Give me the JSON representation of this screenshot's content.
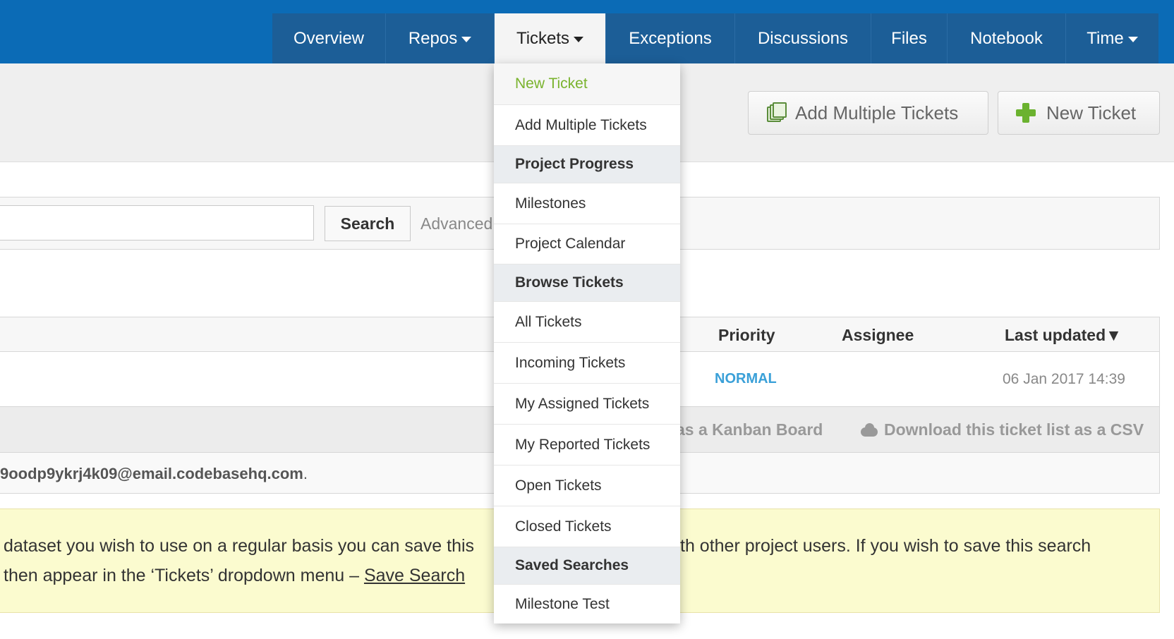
{
  "nav": {
    "items": [
      {
        "label": "Overview",
        "caret": false
      },
      {
        "label": "Repos",
        "caret": true
      },
      {
        "label": "Tickets",
        "caret": true
      },
      {
        "label": "Exceptions",
        "caret": false
      },
      {
        "label": "Discussions",
        "caret": false
      },
      {
        "label": "Files",
        "caret": false
      },
      {
        "label": "Notebook",
        "caret": false
      },
      {
        "label": "Time",
        "caret": true
      }
    ],
    "active": "Tickets"
  },
  "header": {
    "add_multiple_label": "Add Multiple Tickets",
    "new_ticket_label": "New Ticket"
  },
  "search": {
    "value": "",
    "button_label": "Search",
    "advanced_label": "Advanced"
  },
  "table": {
    "columns": [
      "Priority",
      "Assignee",
      "Last updated▼"
    ],
    "row": {
      "priority": "NORMAL",
      "last_updated": "06 Jan 2017 14:39"
    },
    "actions": {
      "kanban_label": "as a Kanban Board",
      "csv_label": "Download this ticket list as a CSV"
    },
    "email_text": "9oodp9ykrj4k09@email.codebasehq.com",
    "email_suffix": "."
  },
  "notice": {
    "line1_left": "dataset you wish to use on a regular basis you can save this",
    "line1_right": "th other project users. If you wish to save this search",
    "line2_left": "then appear in the ‘Tickets’ dropdown menu – ",
    "line2_link": "Save Search"
  },
  "dropdown": {
    "items": [
      {
        "label": "New Ticket",
        "kind": "green"
      },
      {
        "label": "Add Multiple Tickets",
        "kind": "item"
      },
      {
        "label": "Project Progress",
        "kind": "head"
      },
      {
        "label": "Milestones",
        "kind": "item"
      },
      {
        "label": "Project Calendar",
        "kind": "item"
      },
      {
        "label": "Browse Tickets",
        "kind": "head"
      },
      {
        "label": "All Tickets",
        "kind": "item"
      },
      {
        "label": "Incoming Tickets",
        "kind": "item"
      },
      {
        "label": "My Assigned Tickets",
        "kind": "item"
      },
      {
        "label": "My Reported Tickets",
        "kind": "item"
      },
      {
        "label": "Open Tickets",
        "kind": "item"
      },
      {
        "label": "Closed Tickets",
        "kind": "item"
      },
      {
        "label": "Saved Searches",
        "kind": "head"
      },
      {
        "label": "Milestone Test",
        "kind": "item"
      }
    ]
  },
  "colors": {
    "nav_bar": "#0b6bb6",
    "nav_items_bg": "#1c5e97",
    "priority_normal": "#3aa0d8",
    "new_ticket_green": "#7ab32e",
    "notice_bg": "#fbfbcf"
  }
}
